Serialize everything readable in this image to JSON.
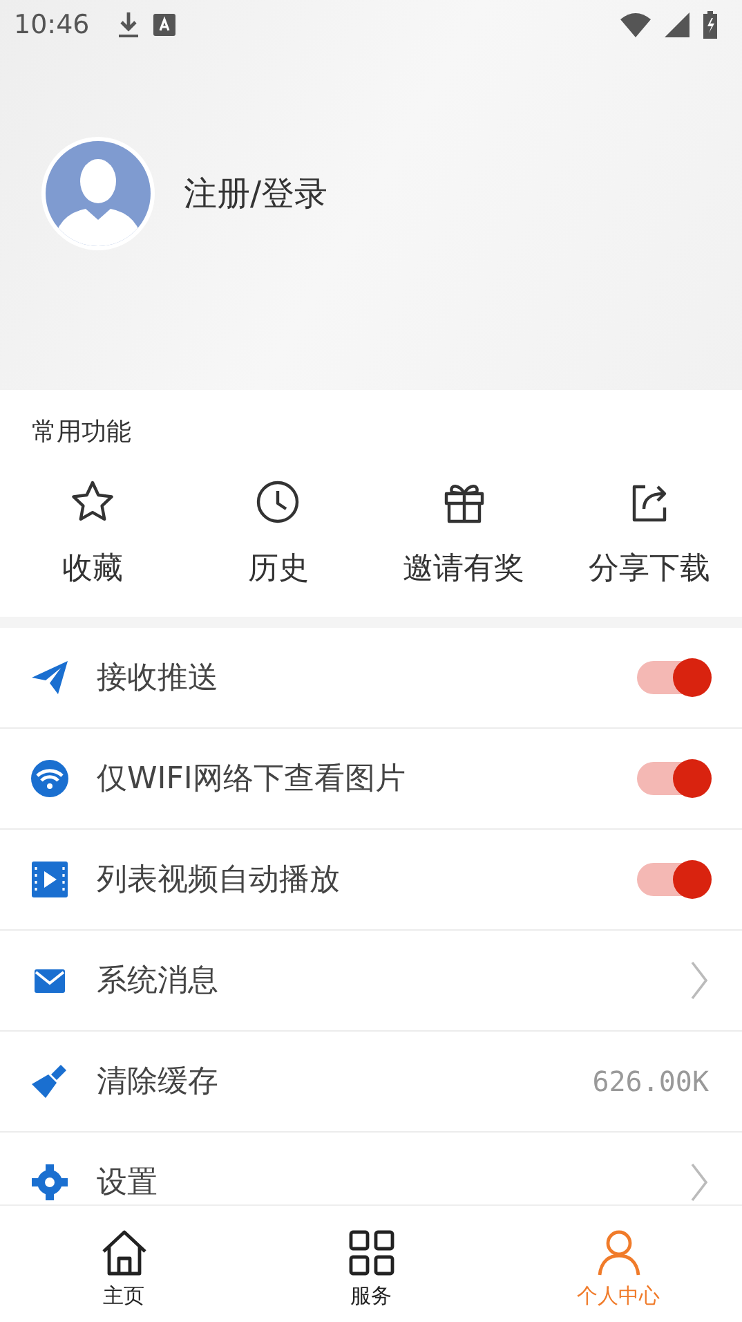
{
  "status_bar": {
    "time": "10:46"
  },
  "profile": {
    "login_label": "注册/登录"
  },
  "common": {
    "title": "常用功能",
    "items": [
      {
        "kind": "star",
        "label": "收藏"
      },
      {
        "kind": "clock",
        "label": "历史"
      },
      {
        "kind": "gift",
        "label": "邀请有奖"
      },
      {
        "kind": "share",
        "label": "分享下载"
      }
    ]
  },
  "settings": [
    {
      "kind": "toggle",
      "label": "接收推送",
      "on": true
    },
    {
      "kind": "toggle",
      "label": "仅WIFI网络下查看图片",
      "on": true
    },
    {
      "kind": "toggle",
      "label": "列表视频自动播放",
      "on": true
    },
    {
      "kind": "link",
      "label": "系统消息"
    },
    {
      "kind": "value",
      "label": "清除缓存",
      "value": "626.00K"
    },
    {
      "kind": "link",
      "label": "设置"
    }
  ],
  "tabs": [
    {
      "kind": "home",
      "label": "主页",
      "selected": false
    },
    {
      "kind": "grid",
      "label": "服务",
      "selected": false
    },
    {
      "kind": "person",
      "label": "个人中心",
      "selected": true
    }
  ]
}
